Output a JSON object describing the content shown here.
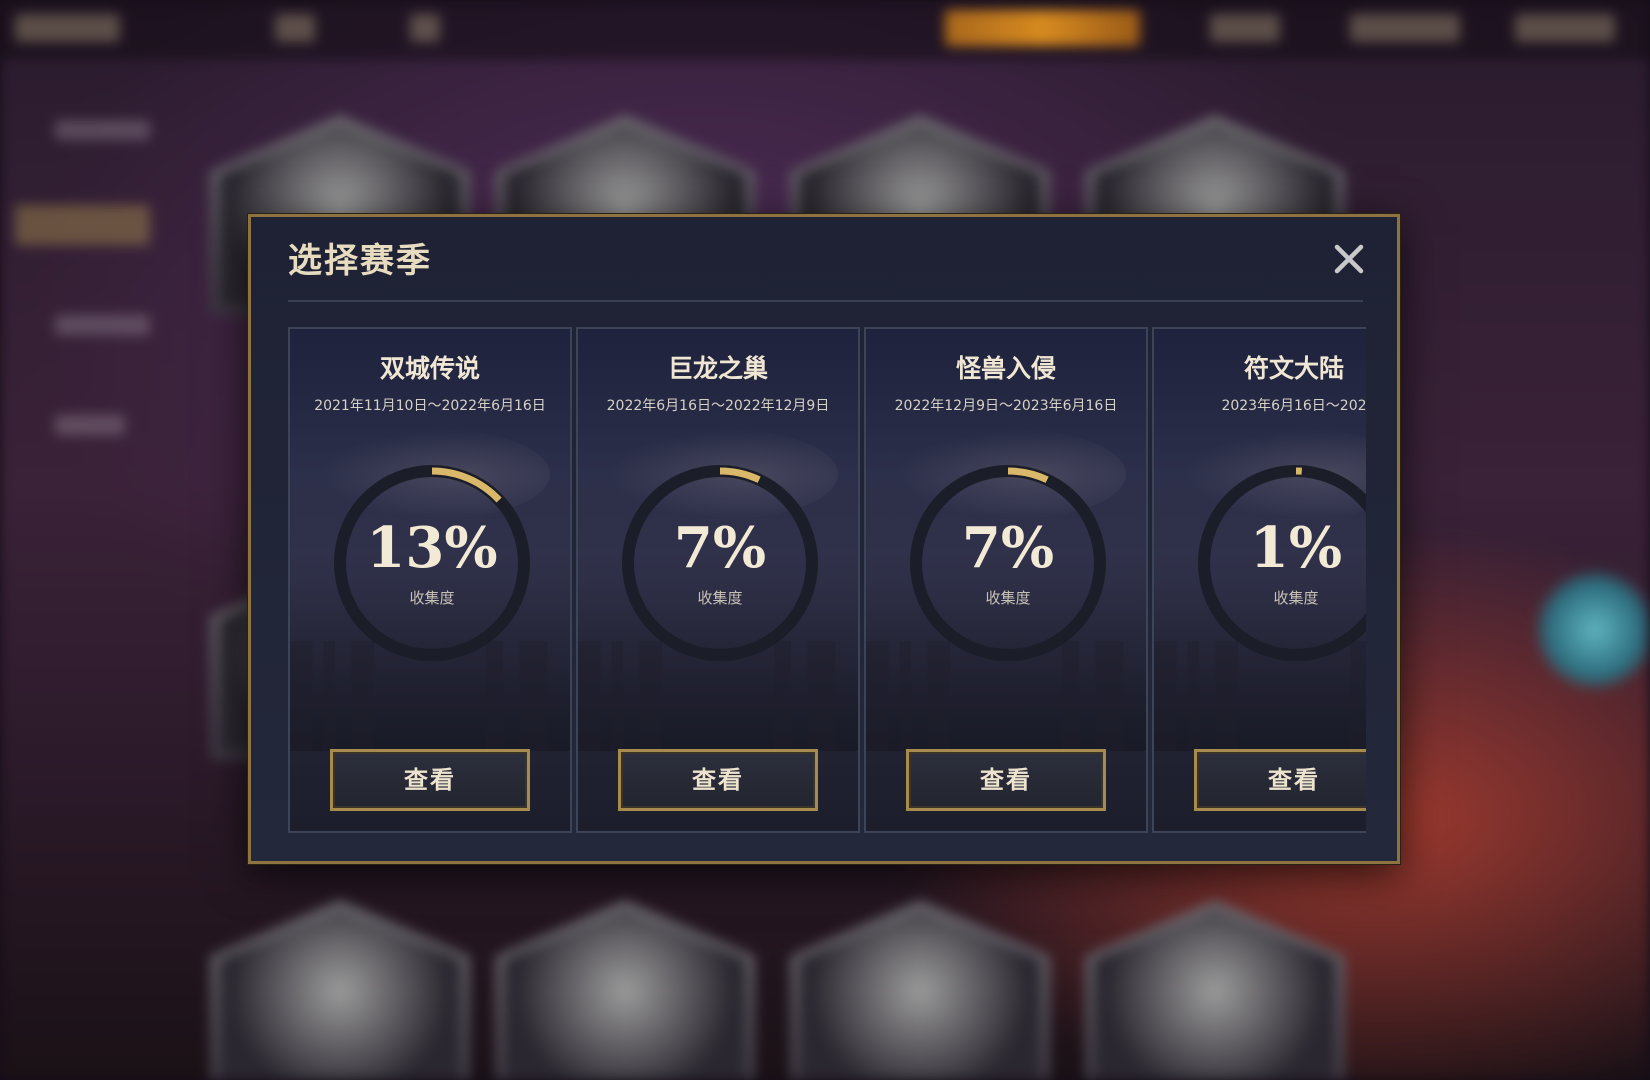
{
  "modal": {
    "title": "选择赛季",
    "close_icon": "close-icon",
    "cards": [
      {
        "title": "双城传说",
        "dates": "2021年11月10日～2022年6月16日",
        "progress_percent": 13,
        "progress_text": "13%",
        "progress_label": "收集度",
        "button_label": "查看"
      },
      {
        "title": "巨龙之巢",
        "dates": "2022年6月16日～2022年12月9日",
        "progress_percent": 7,
        "progress_text": "7%",
        "progress_label": "收集度",
        "button_label": "查看"
      },
      {
        "title": "怪兽入侵",
        "dates": "2022年12月9日～2023年6月16日",
        "progress_percent": 7,
        "progress_text": "7%",
        "progress_label": "收集度",
        "button_label": "查看"
      },
      {
        "title": "符文大陆",
        "dates": "2023年6月16日～202",
        "progress_percent": 1,
        "progress_text": "1%",
        "progress_label": "收集度",
        "button_label": "查看"
      }
    ]
  },
  "colors": {
    "accent_gold": "#d9b869",
    "ring_track": "#1b1d28",
    "modal_border": "#8e7240",
    "top_bar_highlight": "#d68a1f"
  }
}
